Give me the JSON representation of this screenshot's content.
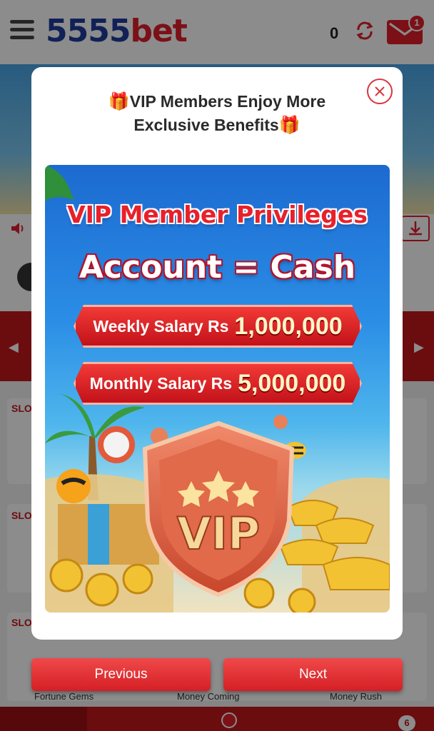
{
  "header": {
    "logo_num": "5555",
    "logo_txt": "bet",
    "balance": "0",
    "mail_badge": "1"
  },
  "background": {
    "slot_tags": [
      "SLO",
      "SLO",
      "SLO"
    ],
    "game_labels": [
      "Fortune Gems",
      "Money Coming",
      "Money Rush"
    ],
    "nav_badge": "6"
  },
  "modal": {
    "title_line1": "VIP Members Enjoy More",
    "title_line2": "Exclusive Benefits",
    "gift_glyph": "🎁",
    "promo": {
      "heading": "VIP Member Privileges",
      "subheading": "Account = Cash",
      "weekly_label": "Weekly Salary Rs",
      "weekly_amount": "1,000,000",
      "monthly_label": "Monthly Salary Rs",
      "monthly_amount": "5,000,000",
      "shield_text": "VIP"
    },
    "buttons": {
      "previous": "Previous",
      "next": "Next"
    }
  },
  "colors": {
    "brand_red": "#e0202a",
    "brand_blue": "#1f3c9e",
    "button_red": "#d41f25"
  },
  "icons": [
    "hamburger-icon",
    "refresh-icon",
    "mail-icon",
    "close-icon",
    "gift-icon",
    "speaker-icon",
    "download-icon"
  ]
}
